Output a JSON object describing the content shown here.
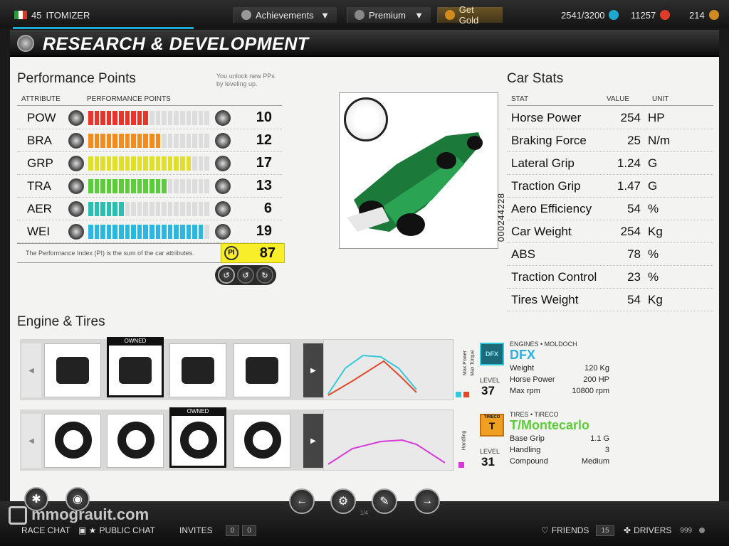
{
  "topbar": {
    "level": "45",
    "username": "ITOMIZER",
    "achievements_label": "Achievements",
    "premium_label": "Premium",
    "get_gold_label": "Get Gold",
    "research_points": "2541/3200",
    "gold": "11257",
    "coins": "214",
    "accent_color": "#1eaad0"
  },
  "page_title": "RESEARCH & DEVELOPMENT",
  "performance": {
    "title": "Performance Points",
    "hint": "You unlock new PPs by leveling up.",
    "col_attribute": "ATTRIBUTE",
    "col_points": "PERFORMANCE POINTS",
    "rows": [
      {
        "attr": "POW",
        "value": "10",
        "filled": 10,
        "color": "#e8352b"
      },
      {
        "attr": "BRA",
        "value": "12",
        "filled": 12,
        "color": "#f28c1e"
      },
      {
        "attr": "GRP",
        "value": "17",
        "filled": 17,
        "color": "#e0e02a"
      },
      {
        "attr": "TRA",
        "value": "13",
        "filled": 13,
        "color": "#5ccc3a"
      },
      {
        "attr": "AER",
        "value": "6",
        "filled": 6,
        "color": "#2bbfb4"
      },
      {
        "attr": "WEI",
        "value": "19",
        "filled": 19,
        "color": "#2ab8e0"
      }
    ],
    "pi_note": "The Performance Index (PI) is the sum of the car attributes.",
    "pi_label": "PI",
    "pi_value": "87"
  },
  "car": {
    "serial": "000244228"
  },
  "car_stats": {
    "title": "Car Stats",
    "col_stat": "STAT",
    "col_value": "VALUE",
    "col_unit": "UNIT",
    "rows": [
      {
        "stat": "Horse Power",
        "value": "254",
        "unit": "HP"
      },
      {
        "stat": "Braking Force",
        "value": "25",
        "unit": "N/m"
      },
      {
        "stat": "Lateral Grip",
        "value": "1.24",
        "unit": "G"
      },
      {
        "stat": "Traction Grip",
        "value": "1.47",
        "unit": "G"
      },
      {
        "stat": "Aero Efficiency",
        "value": "54",
        "unit": "%"
      },
      {
        "stat": "Car Weight",
        "value": "254",
        "unit": "Kg"
      },
      {
        "stat": "ABS",
        "value": "78",
        "unit": "%"
      },
      {
        "stat": "Traction Control",
        "value": "23",
        "unit": "%"
      },
      {
        "stat": "Tires Weight",
        "value": "54",
        "unit": "Kg"
      }
    ]
  },
  "engine_tires": {
    "title": "Engine & Tires",
    "owned_label": "OWNED",
    "engine": {
      "brand_line": "ENGINES • MOLDOCH",
      "name": "DFX",
      "badge": "DFX",
      "level_label": "LEVEL",
      "level": "37",
      "legend_power": "Max Power",
      "legend_torque": "Max Torque",
      "specs": [
        {
          "label": "Weight",
          "value": "120 Kg"
        },
        {
          "label": "Horse Power",
          "value": "200 HP"
        },
        {
          "label": "Max rpm",
          "value": "10800 rpm"
        }
      ]
    },
    "tires": {
      "brand_line": "TIRES • TIRECO",
      "name": "T/Montecarlo",
      "badge": "T",
      "badge_brand": "TIRECO",
      "level_label": "LEVEL",
      "level": "31",
      "legend_handling": "Handling",
      "specs": [
        {
          "label": "Base Grip",
          "value": "1.1 G"
        },
        {
          "label": "Handling",
          "value": "3"
        },
        {
          "label": "Compound",
          "value": "Medium"
        }
      ]
    }
  },
  "bottombar": {
    "page_indicator": "1/4",
    "race_chat": "RACE CHAT",
    "public_chat": "PUBLIC CHAT",
    "invites": "INVITES",
    "invites_count_a": "0",
    "invites_count_b": "0",
    "friends": "FRIENDS",
    "friends_count": "15",
    "drivers": "DRIVERS",
    "drivers_count": "999",
    "watermark": "mmograuit.com"
  }
}
